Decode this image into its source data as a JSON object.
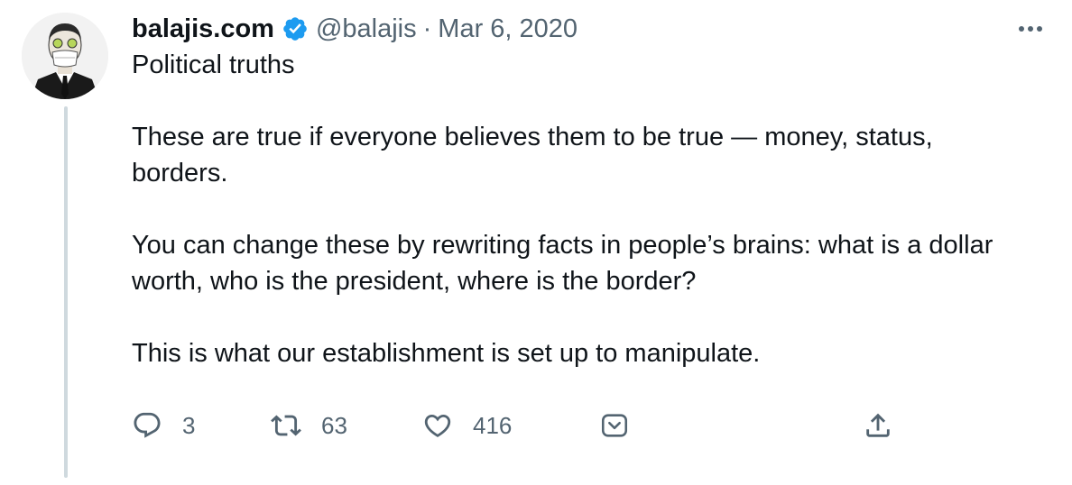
{
  "tweet": {
    "display_name": "balajis.com",
    "handle": "@balajis",
    "separator": "·",
    "date": "Mar 6, 2020",
    "paragraphs": [
      "Political truths",
      "These are true if everyone believes them to be true — money, status, borders.",
      "You can change these by rewriting facts in people’s brains: what is a dollar worth, who is the president, where is the border?",
      "This is what our establishment is set up to manipulate."
    ]
  },
  "actions": {
    "reply_count": "3",
    "retweet_count": "63",
    "like_count": "416"
  },
  "icons": {
    "verified": "verified-badge-icon",
    "more": "more-horizontal-icon",
    "reply": "reply-icon",
    "retweet": "retweet-icon",
    "like": "heart-icon",
    "tip": "tip-jar-icon",
    "share": "share-icon"
  },
  "colors": {
    "text_primary": "#0f1419",
    "text_secondary": "#536471",
    "verified_blue": "#1d9bf0",
    "thread_line": "#cfd9de"
  }
}
